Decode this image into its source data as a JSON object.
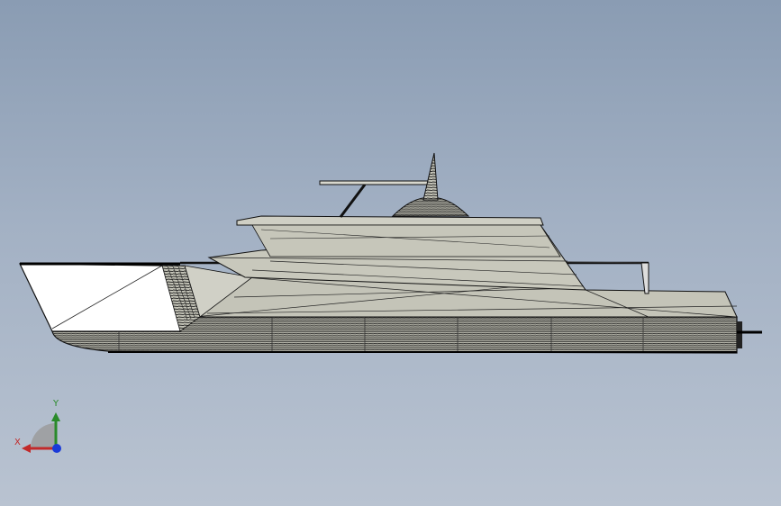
{
  "viewport": {
    "background_top": "#8a9cb3",
    "background_bottom": "#b9c3d1"
  },
  "model": {
    "description_icon": "yacht-model",
    "hull_fill": "#c2c2b6",
    "bow_fill": "#ffffff",
    "edge_color": "#111111"
  },
  "triad": {
    "x_label": "X",
    "y_label": "Y",
    "x_color": "#c22a2a",
    "y_color": "#2a8a2a",
    "z_color": "#1a3ad8"
  }
}
